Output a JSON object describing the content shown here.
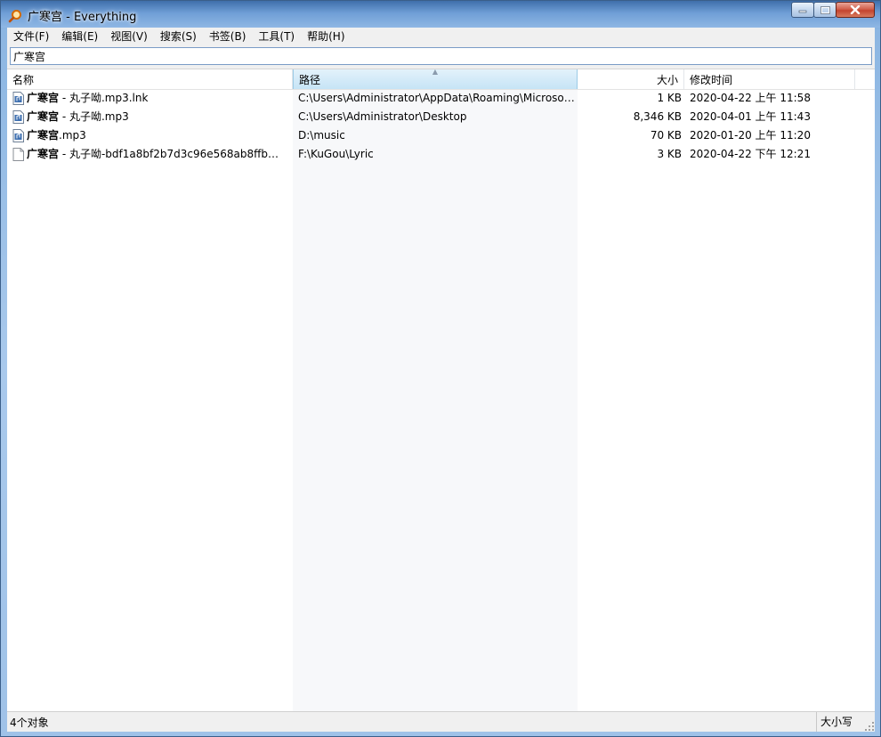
{
  "window": {
    "title": "广寒宫 - Everything",
    "buttons": {
      "minimize": "minimize",
      "maximize": "maximize",
      "close": "close"
    }
  },
  "menu": [
    "文件(F)",
    "编辑(E)",
    "视图(V)",
    "搜索(S)",
    "书签(B)",
    "工具(T)",
    "帮助(H)"
  ],
  "search": {
    "value": "广寒宫"
  },
  "columns": {
    "name": "名称",
    "path": "路径",
    "size": "大小",
    "modified": "修改时间",
    "sorted_column": "路径"
  },
  "rows": [
    {
      "name_bold": "广寒宫",
      "name_rest": " - 丸子呦.mp3.lnk",
      "path": "C:\\Users\\Administrator\\AppData\\Roaming\\Microsof…",
      "size": "1 KB",
      "modified": "2020-04-22 上午 11:58",
      "icon": "audio-file-icon"
    },
    {
      "name_bold": "广寒宫",
      "name_rest": " - 丸子呦.mp3",
      "path": "C:\\Users\\Administrator\\Desktop",
      "size": "8,346 KB",
      "modified": "2020-04-01 上午 11:43",
      "icon": "audio-file-icon"
    },
    {
      "name_bold": "广寒宫",
      "name_rest": ".mp3",
      "path": "D:\\music",
      "size": "70 KB",
      "modified": "2020-01-20 上午 11:20",
      "icon": "audio-file-icon"
    },
    {
      "name_bold": "广寒宫",
      "name_rest": " - 丸子呦-bdf1a8bf2b7d3c96e568ab8ffb1b…",
      "path": "F:\\KuGou\\Lyric",
      "size": "3 KB",
      "modified": "2020-04-22 下午 12:21",
      "icon": "blank-file-icon"
    }
  ],
  "status": {
    "count": "4个对象",
    "match_case": "大小写"
  }
}
